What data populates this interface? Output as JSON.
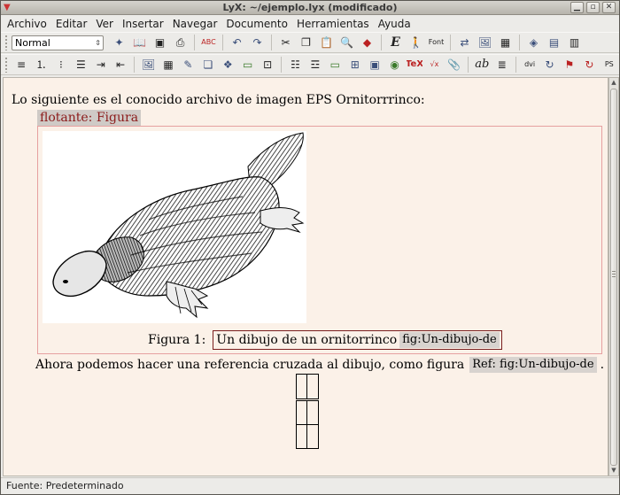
{
  "window": {
    "title": "LyX: ~/ejemplo.lyx (modificado)",
    "controls": [
      "minimize",
      "maximize",
      "close"
    ]
  },
  "menubar": {
    "items": [
      "Archivo",
      "Editar",
      "Ver",
      "Insertar",
      "Navegar",
      "Documento",
      "Herramientas",
      "Ayuda"
    ]
  },
  "toolbar_main": {
    "layout_value": "Normal",
    "icons": [
      "new-document",
      "open-document",
      "save",
      "print",
      "spellcheck",
      "undo",
      "redo",
      "cut",
      "copy",
      "paste",
      "find-replace",
      "change-tracking",
      "emphasis",
      "noun",
      "font",
      "cross-reference",
      "insert-graphics",
      "insert-table",
      "document-settings",
      "toc-view",
      "view-source"
    ],
    "emphasis_glyph": "E",
    "font_glyph": "Font"
  },
  "toolbar_secondary": {
    "icons": [
      "list-none",
      "numbered-list",
      "bullet-list",
      "description",
      "increase-depth",
      "decrease-depth",
      "insert-image",
      "insert-table2",
      "insert-note",
      "insert-footnote",
      "insert-marginal",
      "insert-branch",
      "insert-url",
      "align-left",
      "align-block",
      "insert-index",
      "insert-float",
      "insert-box",
      "tex-code",
      "insert-math",
      "attach",
      "insert-hfill",
      "justify",
      "view-dvi",
      "update-dvi",
      "view-pdf",
      "update-pdf",
      "view-ps"
    ],
    "tex_glyph": "TeX",
    "ab_glyph": "ab"
  },
  "document": {
    "intro_text": "Lo siguiente es el conocido archivo de imagen EPS Ornitorrrinco:",
    "float_label": "flotante: Figura",
    "caption_label": "Figura 1:",
    "caption_text": "Un dibujo de un ornitorrinco",
    "caption_label_inset": "fig:Un-dibujo-de",
    "ref_text_before": "Ahora podemos hacer una referencia cruzada al dibujo, como figura",
    "ref_inset": "Ref: fig:Un-dibujo-de",
    "ref_text_after": "."
  },
  "statusbar": {
    "text": "Fuente: Predeterminado"
  }
}
